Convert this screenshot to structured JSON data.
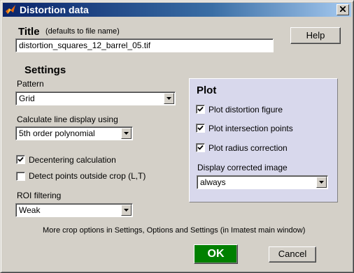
{
  "window": {
    "title": "Distortion data"
  },
  "title_section": {
    "heading": "Title",
    "hint": "(defaults to file name)",
    "value": "distortion_squares_12_barrel_05.tif"
  },
  "help_button": {
    "label": "Help"
  },
  "settings": {
    "heading": "Settings",
    "pattern": {
      "label": "Pattern",
      "value": "Grid"
    },
    "line_display": {
      "label": "Calculate line display using",
      "value": "5th order polynomial"
    },
    "decentering": {
      "label": "Decentering calculation",
      "checked": true
    },
    "detect_points": {
      "label": "Detect points outside crop (L,T)",
      "checked": false
    },
    "roi_filtering": {
      "label": "ROI filtering",
      "value": "Weak"
    }
  },
  "plot": {
    "heading": "Plot",
    "distortion_figure": {
      "label": "Plot distortion figure",
      "checked": true
    },
    "intersection_points": {
      "label": "Plot intersection points",
      "checked": true
    },
    "radius_correction": {
      "label": "Plot radius correction",
      "checked": true
    },
    "display_corrected": {
      "label": "Display corrected image",
      "value": "always"
    }
  },
  "footer": {
    "note": "More crop options in Settings, Options and Settings (in Imatest main window)",
    "ok_label": "OK",
    "cancel_label": "Cancel"
  },
  "colors": {
    "titlebar_start": "#0a246a",
    "titlebar_end": "#a6caf0",
    "ok_button": "#008000",
    "plot_panel": "#d8d8ec",
    "face": "#d4d0c8"
  },
  "icons": {
    "app": "matlab-logo-icon",
    "close": "close-icon",
    "dropdown": "chevron-down-icon",
    "check": "checkmark-icon"
  }
}
